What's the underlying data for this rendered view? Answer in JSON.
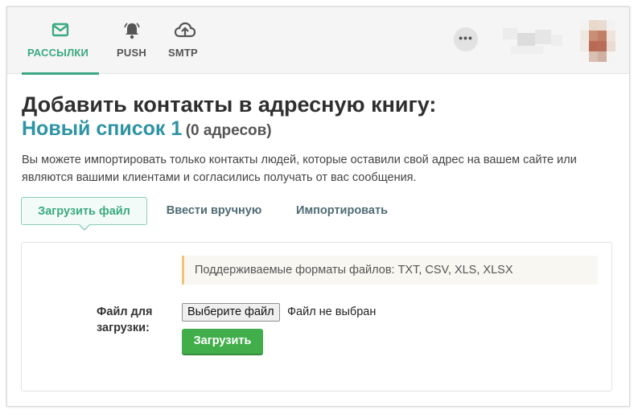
{
  "nav": {
    "tabs": [
      {
        "label": "РАССЫЛКИ",
        "icon": "envelope-icon",
        "active": true
      },
      {
        "label": "PUSH",
        "icon": "bell-icon",
        "active": false
      },
      {
        "label": "SMTP",
        "icon": "cloud-upload-icon",
        "active": false
      }
    ],
    "more_label": "•••"
  },
  "page": {
    "heading": "Добавить контакты в адресную книгу:",
    "list_name": "Новый список 1",
    "address_count": "(0 адресов)",
    "description": "Вы можете импортировать только контакты людей, которые оставили свой адрес на вашем сайте или являются вашими клиентами и согласились получать от вас сообщения."
  },
  "subtabs": [
    {
      "label": "Загрузить файл",
      "active": true
    },
    {
      "label": "Ввести вручную",
      "active": false
    },
    {
      "label": "Импортировать",
      "active": false
    }
  ],
  "upload": {
    "formats_notice": "Поддерживаемые форматы файлов: TXT, CSV, XLS, XLSX",
    "field_label": "Файл для загрузки:",
    "choose_button": "Выберите файл",
    "file_status": "Файл не выбран",
    "submit_button": "Загрузить"
  },
  "colors": {
    "accent": "#3aa981",
    "list_name": "#2d93a5",
    "upload_button": "#42ae4b",
    "notice_border": "#f3c27a"
  }
}
